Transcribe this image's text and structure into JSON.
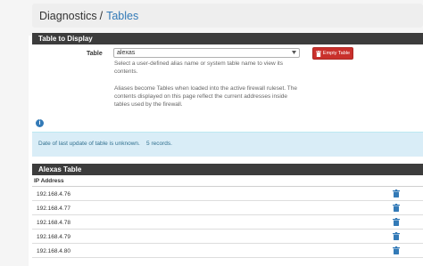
{
  "breadcrumb": {
    "section": "Diagnostics",
    "separator": "/",
    "page": "Tables"
  },
  "panel": {
    "title": "Table to Display",
    "table_label": "Table",
    "selected_table": "alexas",
    "help_line1": "Select a user-defined alias name or system table name to view its",
    "help_line2": "contents.",
    "note_line1": "Aliases become Tables when loaded into the active firewall ruleset. The",
    "note_line2": "contents displayed on this page reflect the current addresses inside",
    "note_line3": "tables used by the firewall.",
    "empty_button": "Empty Table"
  },
  "info": {
    "icon": "info-circle-icon",
    "message": "Date of last update of table is unknown.    5 records."
  },
  "table": {
    "title": "Alexas Table",
    "column": "IP Address",
    "rows": [
      "192.168.4.76",
      "192.168.4.77",
      "192.168.4.78",
      "192.168.4.79",
      "192.168.4.80"
    ]
  },
  "colors": {
    "heading_bg": "#3c3c3c",
    "danger": "#c9302c",
    "link": "#337ab7",
    "info_bg": "#d9edf7"
  }
}
